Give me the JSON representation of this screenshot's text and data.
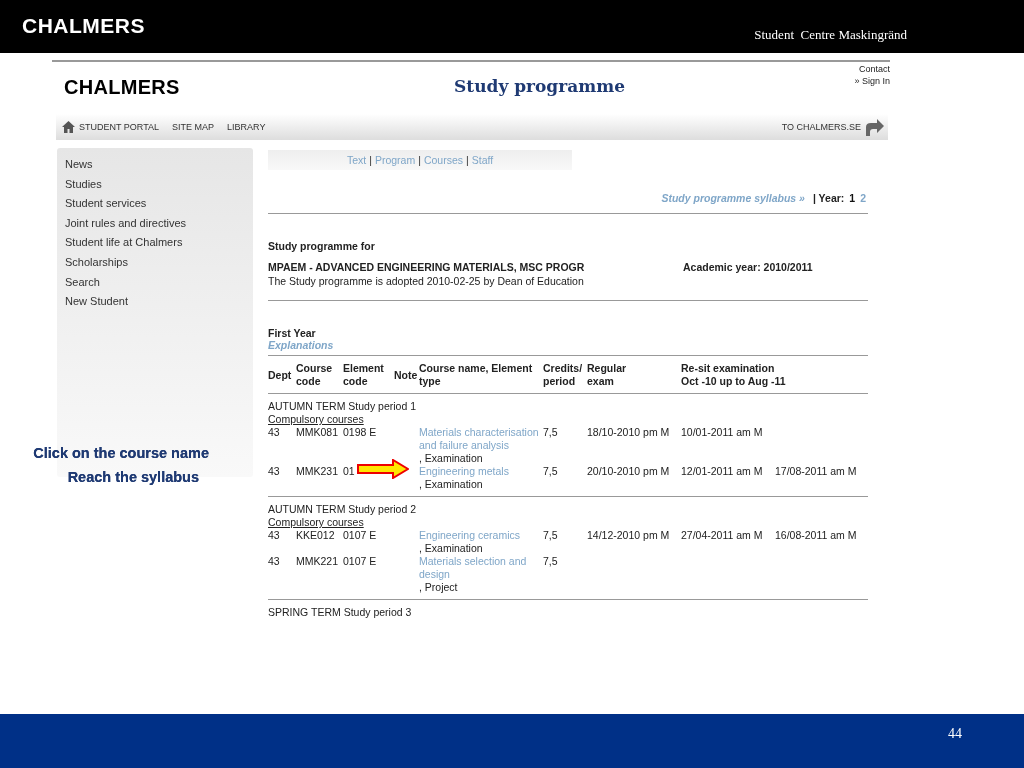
{
  "slide": {
    "logo": "CHALMERS",
    "subtitle": "Student  Centre Maskingränd",
    "page_number": "44",
    "callouts": [
      "Click on the course name",
      "Reach the syllabus"
    ]
  },
  "site": {
    "logo": "CHALMERS",
    "title": "Study programme",
    "top_links": [
      "Contact",
      "» Sign In"
    ],
    "nav": {
      "items": [
        "STUDENT PORTAL",
        "SITE MAP",
        "LIBRARY"
      ],
      "right_link": "TO CHALMERS.SE"
    },
    "sidebar": {
      "items": [
        "News",
        "Studies",
        "Student services",
        "Joint rules and directives",
        "Student life at Chalmers",
        "Scholarships",
        "Search",
        "New Student"
      ]
    },
    "subnav": {
      "links": [
        "Text",
        "Program",
        "Courses",
        "Staff"
      ],
      "separator": "|"
    },
    "syllabus_link": "Study programme syllabus »",
    "year_label": "| Year:",
    "years": [
      {
        "label": "1",
        "selected": true
      },
      {
        "label": "2",
        "selected": false
      }
    ],
    "programme_heading": "Study programme for",
    "programme_name": "MPAEM - ADVANCED ENGINEERING MATERIALS, MSC PROGR",
    "academic_year": "Academic year: 2010/2011",
    "adopted": "The Study programme is adopted 2010-02-25 by Dean of Education",
    "year_heading": "First Year",
    "explanations_link": "Explanations",
    "table": {
      "columns": [
        {
          "lines": [
            "Dept"
          ]
        },
        {
          "lines": [
            "Course",
            "code"
          ]
        },
        {
          "lines": [
            "Element",
            "code"
          ]
        },
        {
          "lines": [
            "Note"
          ]
        },
        {
          "lines": [
            "Course name, Element",
            "type"
          ]
        },
        {
          "lines": [
            "Credits/",
            "period"
          ]
        },
        {
          "lines": [
            "Regular",
            "exam"
          ]
        },
        {
          "lines": [
            "Re-sit examination",
            "Oct -10 up to Aug -11"
          ]
        }
      ],
      "sections": [
        {
          "term": "AUTUMN TERM Study period 1",
          "group": "Compulsory courses",
          "rows": [
            {
              "dept": "43",
              "course_code": "MMK081",
              "element_code": "0198 E",
              "course_name": "Materials characterisation and failure analysis",
              "element_type": ", Examination",
              "credits": "7,5",
              "regular_exam": "18/10-2010 pm M",
              "resit_1": "10/01-2011 am M",
              "pointed": false
            },
            {
              "dept": "43",
              "course_code": "MMK231",
              "element_code": "01",
              "course_name": "Engineering metals",
              "element_type": ", Examination",
              "credits": "7,5",
              "regular_exam": "20/10-2010 pm M",
              "resit_1": "12/01-2011 am M",
              "resit_2": "17/08-2011 am M",
              "pointed": true
            }
          ]
        },
        {
          "term": "AUTUMN TERM Study period 2",
          "group": "Compulsory courses",
          "rows": [
            {
              "dept": "43",
              "course_code": "KKE012",
              "element_code": "0107 E",
              "course_name": "Engineering ceramics",
              "element_type": ", Examination",
              "credits": "7,5",
              "regular_exam": "14/12-2010 pm M",
              "resit_1": "27/04-2011 am M",
              "resit_2": "16/08-2011 am M",
              "pointed": false
            },
            {
              "dept": "43",
              "course_code": "MMK221",
              "element_code": "0107 E",
              "course_name": "Materials selection and design",
              "element_type": ", Project",
              "credits": "7,5",
              "pointed": false
            }
          ]
        },
        {
          "term": "SPRING TERM Study period 3"
        }
      ]
    }
  }
}
